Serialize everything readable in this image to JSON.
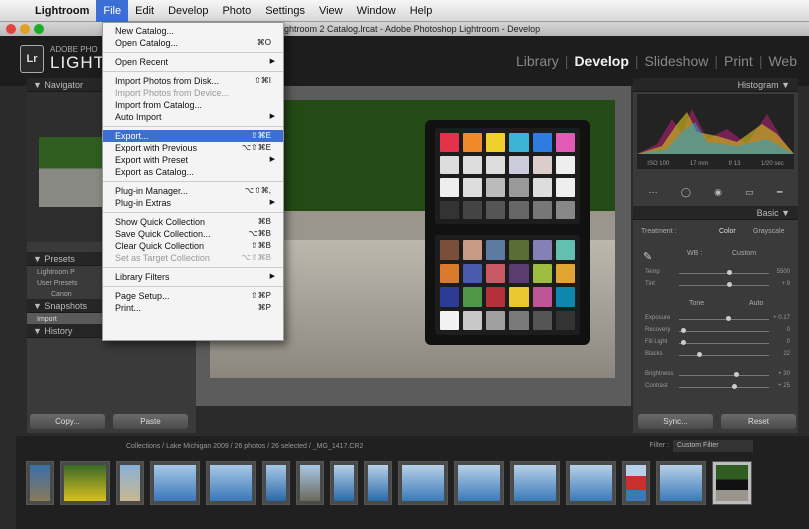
{
  "menubar": {
    "items": [
      "Lightroom",
      "File",
      "Edit",
      "Develop",
      "Photo",
      "Settings",
      "View",
      "Window",
      "Help"
    ],
    "active": "File"
  },
  "window": {
    "title": "ghtroom 2 Catalog.lrcat - Adobe Photoshop Lightroom - Develop"
  },
  "identity": {
    "line1": "ADOBE PHO",
    "line2": "LIGHTR",
    "badge": "Lr"
  },
  "modules": [
    "Library",
    "Develop",
    "Slideshow",
    "Print",
    "Web"
  ],
  "active_module": "Develop",
  "left": {
    "navigator": "Navigator",
    "presets": "Presets",
    "preset_items": [
      "Lightroom P",
      "User Presets",
      "Canon"
    ],
    "snapshots": "Snapshots",
    "snapshot_item": "Import",
    "history": "History",
    "copy": "Copy...",
    "paste": "Paste"
  },
  "right": {
    "histogram": "Histogram",
    "hist_info": [
      "ISO 100",
      "17 mm",
      "f/ 13",
      "1/20 sec"
    ],
    "basic": "Basic",
    "treatment": "Treatment :",
    "color": "Color",
    "grayscale": "Grayscale",
    "wb_label": "WB :",
    "wb_value": "Custom",
    "sliders": [
      {
        "label": "Temp",
        "value": "5500",
        "pos": 0.55
      },
      {
        "label": "Tint",
        "value": "+ 9",
        "pos": 0.55
      },
      {
        "label": "Exposure",
        "value": "+ 0.17",
        "pos": 0.53
      },
      {
        "label": "Recovery",
        "value": "0",
        "pos": 0.02
      },
      {
        "label": "Fill Light",
        "value": "0",
        "pos": 0.02
      },
      {
        "label": "Blacks",
        "value": "22",
        "pos": 0.2
      },
      {
        "label": "Brightness",
        "value": "+ 30",
        "pos": 0.62
      },
      {
        "label": "Contrast",
        "value": "+ 25",
        "pos": 0.6
      }
    ],
    "tone": "Tone",
    "auto": "Auto",
    "sync": "Sync...",
    "reset": "Reset"
  },
  "filmstrip": {
    "path": "Collections / Lake Michigan 2009 / 26 photos / 26 selected / _MG_1417.CR2",
    "filter_label": "Filter :",
    "filter_value": "Custom Filter"
  },
  "file_menu": [
    {
      "label": "New Catalog...",
      "shortcut": ""
    },
    {
      "label": "Open Catalog...",
      "shortcut": "⌘O"
    },
    {
      "sep": true
    },
    {
      "label": "Open Recent",
      "sub": true
    },
    {
      "sep": true
    },
    {
      "label": "Import Photos from Disk...",
      "shortcut": "⇧⌘I"
    },
    {
      "label": "Import Photos from Device...",
      "disabled": true
    },
    {
      "label": "Import from Catalog..."
    },
    {
      "label": "Auto Import",
      "sub": true
    },
    {
      "sep": true
    },
    {
      "label": "Export...",
      "shortcut": "⇧⌘E",
      "highlight": true
    },
    {
      "label": "Export with Previous",
      "shortcut": "⌥⇧⌘E"
    },
    {
      "label": "Export with Preset",
      "sub": true
    },
    {
      "label": "Export as Catalog..."
    },
    {
      "sep": true
    },
    {
      "label": "Plug-in Manager...",
      "shortcut": "⌥⇧⌘,"
    },
    {
      "label": "Plug-in Extras",
      "sub": true
    },
    {
      "sep": true
    },
    {
      "label": "Show Quick Collection",
      "shortcut": "⌘B"
    },
    {
      "label": "Save Quick Collection...",
      "shortcut": "⌥⌘B"
    },
    {
      "label": "Clear Quick Collection",
      "shortcut": "⇧⌘B"
    },
    {
      "label": "Set as Target Collection",
      "shortcut": "⌥⇧⌘B",
      "disabled": true
    },
    {
      "sep": true
    },
    {
      "label": "Library Filters",
      "sub": true
    },
    {
      "sep": true
    },
    {
      "label": "Page Setup...",
      "shortcut": "⇧⌘P"
    },
    {
      "label": "Print...",
      "shortcut": "⌘P"
    }
  ],
  "colors": {
    "accent": "#3b6fd6",
    "panel": "#3a3a3a",
    "dark": "#1d1d1d"
  }
}
